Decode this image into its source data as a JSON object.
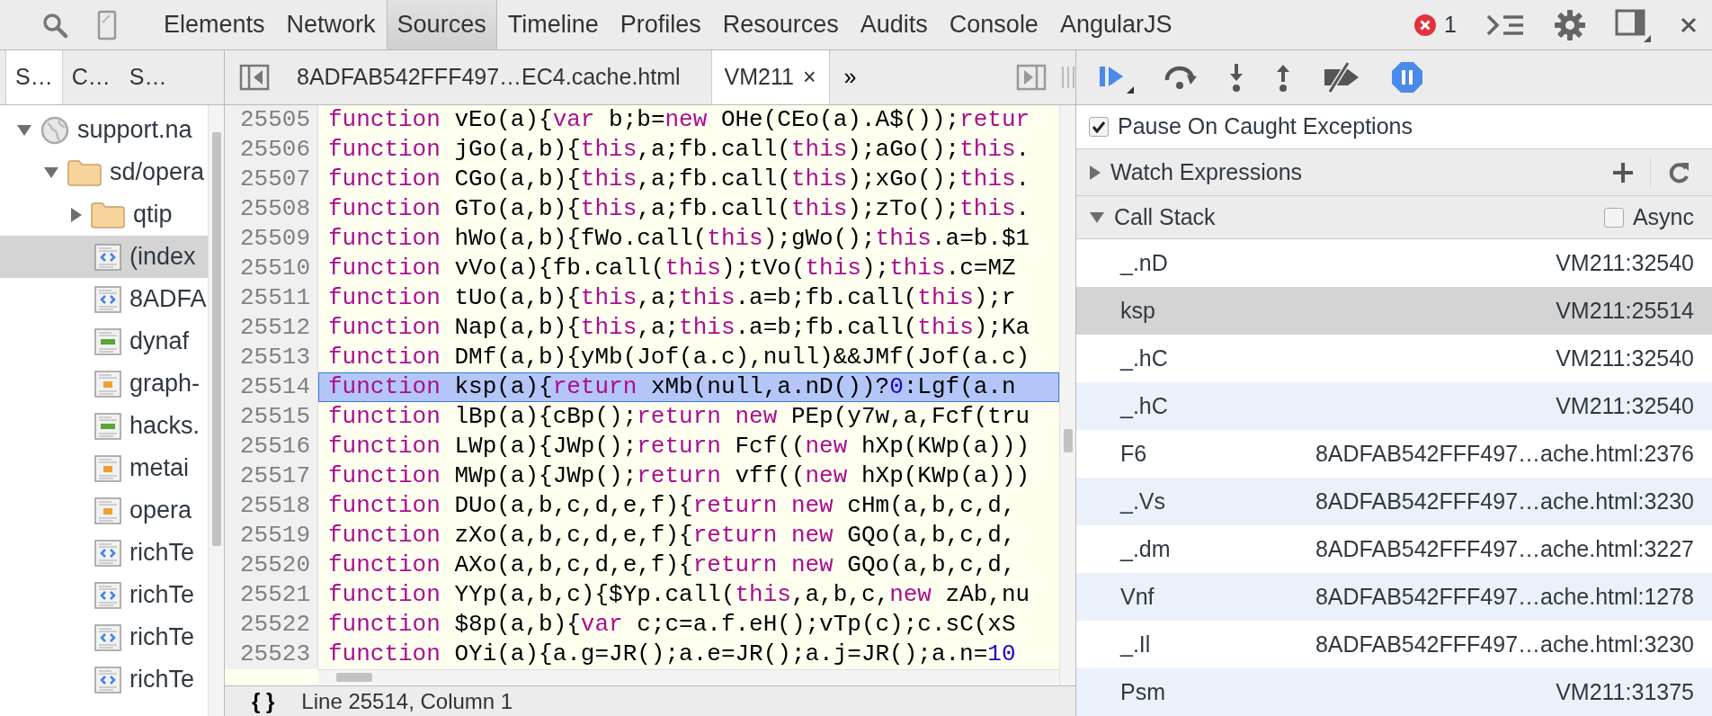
{
  "toolbar": {
    "tabs": [
      {
        "label": "Elements",
        "selected": false
      },
      {
        "label": "Network",
        "selected": false
      },
      {
        "label": "Sources",
        "selected": true
      },
      {
        "label": "Timeline",
        "selected": false
      },
      {
        "label": "Profiles",
        "selected": false
      },
      {
        "label": "Resources",
        "selected": false
      },
      {
        "label": "Audits",
        "selected": false
      },
      {
        "label": "Console",
        "selected": false
      },
      {
        "label": "AngularJS",
        "selected": false
      }
    ],
    "error_count": "1"
  },
  "navigator": {
    "tabs": [
      {
        "label": "S…",
        "selected": true
      },
      {
        "label": "C…",
        "selected": false
      },
      {
        "label": "S…",
        "selected": false
      }
    ],
    "tree": [
      {
        "label": "support.na",
        "kind": "domain",
        "expanded": true,
        "selected": false,
        "children": [
          {
            "label": "sd/opera",
            "kind": "folder",
            "expanded": true,
            "selected": false,
            "children": [
              {
                "label": "qtip",
                "kind": "folder",
                "expanded": false,
                "selected": false
              },
              {
                "label": "(index",
                "kind": "html",
                "selected": true
              },
              {
                "label": "8ADFA",
                "kind": "html",
                "selected": false
              },
              {
                "label": "dynaf",
                "kind": "css",
                "selected": false
              },
              {
                "label": "graph-",
                "kind": "js",
                "selected": false
              },
              {
                "label": "hacks.",
                "kind": "css",
                "selected": false
              },
              {
                "label": "metai",
                "kind": "js",
                "selected": false
              },
              {
                "label": "opera",
                "kind": "js",
                "selected": false
              },
              {
                "label": "richTe",
                "kind": "html",
                "selected": false
              },
              {
                "label": "richTe",
                "kind": "html",
                "selected": false
              },
              {
                "label": "richTe",
                "kind": "html",
                "selected": false
              },
              {
                "label": "richTe",
                "kind": "html",
                "selected": false
              }
            ]
          }
        ]
      }
    ]
  },
  "editor": {
    "tabs": [
      {
        "label": "8ADFAB542FFF497…EC4.cache.html",
        "selected": false
      },
      {
        "label": "VM211",
        "selected": true,
        "close": "×"
      }
    ],
    "more": "»",
    "lines": [
      {
        "number": "25505",
        "selected": false,
        "tokens": [
          {
            "kind": "keyword",
            "text": "function"
          },
          {
            "kind": "plain",
            "text": " vEo(a){"
          },
          {
            "kind": "keyword",
            "text": "var"
          },
          {
            "kind": "plain",
            "text": " b;b="
          },
          {
            "kind": "keyword",
            "text": "new"
          },
          {
            "kind": "plain",
            "text": " OHe(CEo(a).A$());"
          },
          {
            "kind": "keyword",
            "text": "retur"
          }
        ]
      },
      {
        "number": "25506",
        "selected": false,
        "tokens": [
          {
            "kind": "keyword",
            "text": "function"
          },
          {
            "kind": "plain",
            "text": " jGo(a,b){"
          },
          {
            "kind": "keyword",
            "text": "this"
          },
          {
            "kind": "plain",
            "text": ",a;fb.call("
          },
          {
            "kind": "keyword",
            "text": "this"
          },
          {
            "kind": "plain",
            "text": ");aGo();"
          },
          {
            "kind": "keyword",
            "text": "this"
          },
          {
            "kind": "plain",
            "text": "."
          }
        ]
      },
      {
        "number": "25507",
        "selected": false,
        "tokens": [
          {
            "kind": "keyword",
            "text": "function"
          },
          {
            "kind": "plain",
            "text": " CGo(a,b){"
          },
          {
            "kind": "keyword",
            "text": "this"
          },
          {
            "kind": "plain",
            "text": ",a;fb.call("
          },
          {
            "kind": "keyword",
            "text": "this"
          },
          {
            "kind": "plain",
            "text": ");xGo();"
          },
          {
            "kind": "keyword",
            "text": "this"
          },
          {
            "kind": "plain",
            "text": "."
          }
        ]
      },
      {
        "number": "25508",
        "selected": false,
        "tokens": [
          {
            "kind": "keyword",
            "text": "function"
          },
          {
            "kind": "plain",
            "text": " GTo(a,b){"
          },
          {
            "kind": "keyword",
            "text": "this"
          },
          {
            "kind": "plain",
            "text": ",a;fb.call("
          },
          {
            "kind": "keyword",
            "text": "this"
          },
          {
            "kind": "plain",
            "text": ");zTo();"
          },
          {
            "kind": "keyword",
            "text": "this"
          },
          {
            "kind": "plain",
            "text": "."
          }
        ]
      },
      {
        "number": "25509",
        "selected": false,
        "tokens": [
          {
            "kind": "keyword",
            "text": "function"
          },
          {
            "kind": "plain",
            "text": " hWo(a,b){fWo.call("
          },
          {
            "kind": "keyword",
            "text": "this"
          },
          {
            "kind": "plain",
            "text": ");gWo();"
          },
          {
            "kind": "keyword",
            "text": "this"
          },
          {
            "kind": "plain",
            "text": ".a=b.$1"
          }
        ]
      },
      {
        "number": "25510",
        "selected": false,
        "tokens": [
          {
            "kind": "keyword",
            "text": "function"
          },
          {
            "kind": "plain",
            "text": " vVo(a){fb.call("
          },
          {
            "kind": "keyword",
            "text": "this"
          },
          {
            "kind": "plain",
            "text": ");tVo("
          },
          {
            "kind": "keyword",
            "text": "this"
          },
          {
            "kind": "plain",
            "text": ");"
          },
          {
            "kind": "keyword",
            "text": "this"
          },
          {
            "kind": "plain",
            "text": ".c=MZ"
          }
        ]
      },
      {
        "number": "25511",
        "selected": false,
        "tokens": [
          {
            "kind": "keyword",
            "text": "function"
          },
          {
            "kind": "plain",
            "text": " tUo(a,b){"
          },
          {
            "kind": "keyword",
            "text": "this"
          },
          {
            "kind": "plain",
            "text": ",a;"
          },
          {
            "kind": "keyword",
            "text": "this"
          },
          {
            "kind": "plain",
            "text": ".a=b;fb.call("
          },
          {
            "kind": "keyword",
            "text": "this"
          },
          {
            "kind": "plain",
            "text": ");r"
          }
        ]
      },
      {
        "number": "25512",
        "selected": false,
        "tokens": [
          {
            "kind": "keyword",
            "text": "function"
          },
          {
            "kind": "plain",
            "text": " Nap(a,b){"
          },
          {
            "kind": "keyword",
            "text": "this"
          },
          {
            "kind": "plain",
            "text": ",a;"
          },
          {
            "kind": "keyword",
            "text": "this"
          },
          {
            "kind": "plain",
            "text": ".a=b;fb.call("
          },
          {
            "kind": "keyword",
            "text": "this"
          },
          {
            "kind": "plain",
            "text": ");Ka"
          }
        ]
      },
      {
        "number": "25513",
        "selected": false,
        "tokens": [
          {
            "kind": "keyword",
            "text": "function"
          },
          {
            "kind": "plain",
            "text": " DMf(a,b){yMb(Jof(a.c),null)&&JMf(Jof(a.c)"
          }
        ]
      },
      {
        "number": "25514",
        "selected": true,
        "tokens": [
          {
            "kind": "keyword",
            "text": "function"
          },
          {
            "kind": "plain",
            "text": " ksp(a){"
          },
          {
            "kind": "keyword",
            "text": "return"
          },
          {
            "kind": "plain",
            "text": " xMb(null,a.nD())?"
          },
          {
            "kind": "number",
            "text": "0"
          },
          {
            "kind": "plain",
            "text": ":Lgf(a.n"
          }
        ]
      },
      {
        "number": "25515",
        "selected": false,
        "tokens": [
          {
            "kind": "keyword",
            "text": "function"
          },
          {
            "kind": "plain",
            "text": " lBp(a){cBp();"
          },
          {
            "kind": "keyword",
            "text": "return"
          },
          {
            "kind": "keyword",
            "text": " new"
          },
          {
            "kind": "plain",
            "text": " PEp(y7w,a,Fcf(tru"
          }
        ]
      },
      {
        "number": "25516",
        "selected": false,
        "tokens": [
          {
            "kind": "keyword",
            "text": "function"
          },
          {
            "kind": "plain",
            "text": " LWp(a){JWp();"
          },
          {
            "kind": "keyword",
            "text": "return"
          },
          {
            "kind": "plain",
            "text": " Fcf(("
          },
          {
            "kind": "keyword",
            "text": "new"
          },
          {
            "kind": "plain",
            "text": " hXp(KWp(a)))"
          }
        ]
      },
      {
        "number": "25517",
        "selected": false,
        "tokens": [
          {
            "kind": "keyword",
            "text": "function"
          },
          {
            "kind": "plain",
            "text": " MWp(a){JWp();"
          },
          {
            "kind": "keyword",
            "text": "return"
          },
          {
            "kind": "plain",
            "text": " vff(("
          },
          {
            "kind": "keyword",
            "text": "new"
          },
          {
            "kind": "plain",
            "text": " hXp(KWp(a)))"
          }
        ]
      },
      {
        "number": "25518",
        "selected": false,
        "tokens": [
          {
            "kind": "keyword",
            "text": "function"
          },
          {
            "kind": "plain",
            "text": " DUo(a,b,c,d,e,f){"
          },
          {
            "kind": "keyword",
            "text": "return"
          },
          {
            "kind": "keyword",
            "text": " new"
          },
          {
            "kind": "plain",
            "text": " cHm(a,b,c,d,"
          }
        ]
      },
      {
        "number": "25519",
        "selected": false,
        "tokens": [
          {
            "kind": "keyword",
            "text": "function"
          },
          {
            "kind": "plain",
            "text": " zXo(a,b,c,d,e,f){"
          },
          {
            "kind": "keyword",
            "text": "return"
          },
          {
            "kind": "keyword",
            "text": " new"
          },
          {
            "kind": "plain",
            "text": " GQo(a,b,c,d,"
          }
        ]
      },
      {
        "number": "25520",
        "selected": false,
        "tokens": [
          {
            "kind": "keyword",
            "text": "function"
          },
          {
            "kind": "plain",
            "text": " AXo(a,b,c,d,e,f){"
          },
          {
            "kind": "keyword",
            "text": "return"
          },
          {
            "kind": "keyword",
            "text": " new"
          },
          {
            "kind": "plain",
            "text": " GQo(a,b,c,d,"
          }
        ]
      },
      {
        "number": "25521",
        "selected": false,
        "tokens": [
          {
            "kind": "keyword",
            "text": "function"
          },
          {
            "kind": "plain",
            "text": " YYp(a,b,c){$Yp.call("
          },
          {
            "kind": "keyword",
            "text": "this"
          },
          {
            "kind": "plain",
            "text": ",a,b,c,"
          },
          {
            "kind": "keyword",
            "text": "new"
          },
          {
            "kind": "plain",
            "text": " zAb,nu"
          }
        ]
      },
      {
        "number": "25522",
        "selected": false,
        "tokens": [
          {
            "kind": "keyword",
            "text": "function"
          },
          {
            "kind": "plain",
            "text": " $8p(a,b){"
          },
          {
            "kind": "keyword",
            "text": "var"
          },
          {
            "kind": "plain",
            "text": " c;c=a.f.eH();vTp(c);c.sC(xS"
          }
        ]
      },
      {
        "number": "25523",
        "selected": false,
        "tokens": [
          {
            "kind": "keyword",
            "text": "function"
          },
          {
            "kind": "plain",
            "text": " OYi(a){a.g=JR();a.e=JR();a.j=JR();a.n="
          },
          {
            "kind": "number",
            "text": "10"
          }
        ]
      }
    ],
    "status": {
      "pretty_print": "{ }",
      "position": "Line 25514, Column 1"
    }
  },
  "debugger": {
    "pause_on_caught": {
      "label": "Pause On Caught Exceptions",
      "checked": true
    },
    "watch": {
      "title": "Watch Expressions",
      "expanded": false
    },
    "call_stack": {
      "title": "Call Stack",
      "expanded": true,
      "async": {
        "label": "Async",
        "checked": false
      },
      "frames": [
        {
          "function": "_.nD",
          "location": "VM211:32540",
          "selected": false
        },
        {
          "function": "ksp",
          "location": "VM211:25514",
          "selected": true
        },
        {
          "function": "_.hC",
          "location": "VM211:32540",
          "selected": false
        },
        {
          "function": "_.hC",
          "location": "VM211:32540",
          "selected": false
        },
        {
          "function": "F6",
          "location": "8ADFAB542FFF497…ache.html:2376",
          "selected": false
        },
        {
          "function": "_.Vs",
          "location": "8ADFAB542FFF497…ache.html:3230",
          "selected": false
        },
        {
          "function": "_.dm",
          "location": "8ADFAB542FFF497…ache.html:3227",
          "selected": false
        },
        {
          "function": "Vnf",
          "location": "8ADFAB542FFF497…ache.html:1278",
          "selected": false
        },
        {
          "function": "_.Il",
          "location": "8ADFAB542FFF497…ache.html:3230",
          "selected": false
        },
        {
          "function": "Psm",
          "location": "VM211:31375",
          "selected": false
        }
      ]
    }
  }
}
